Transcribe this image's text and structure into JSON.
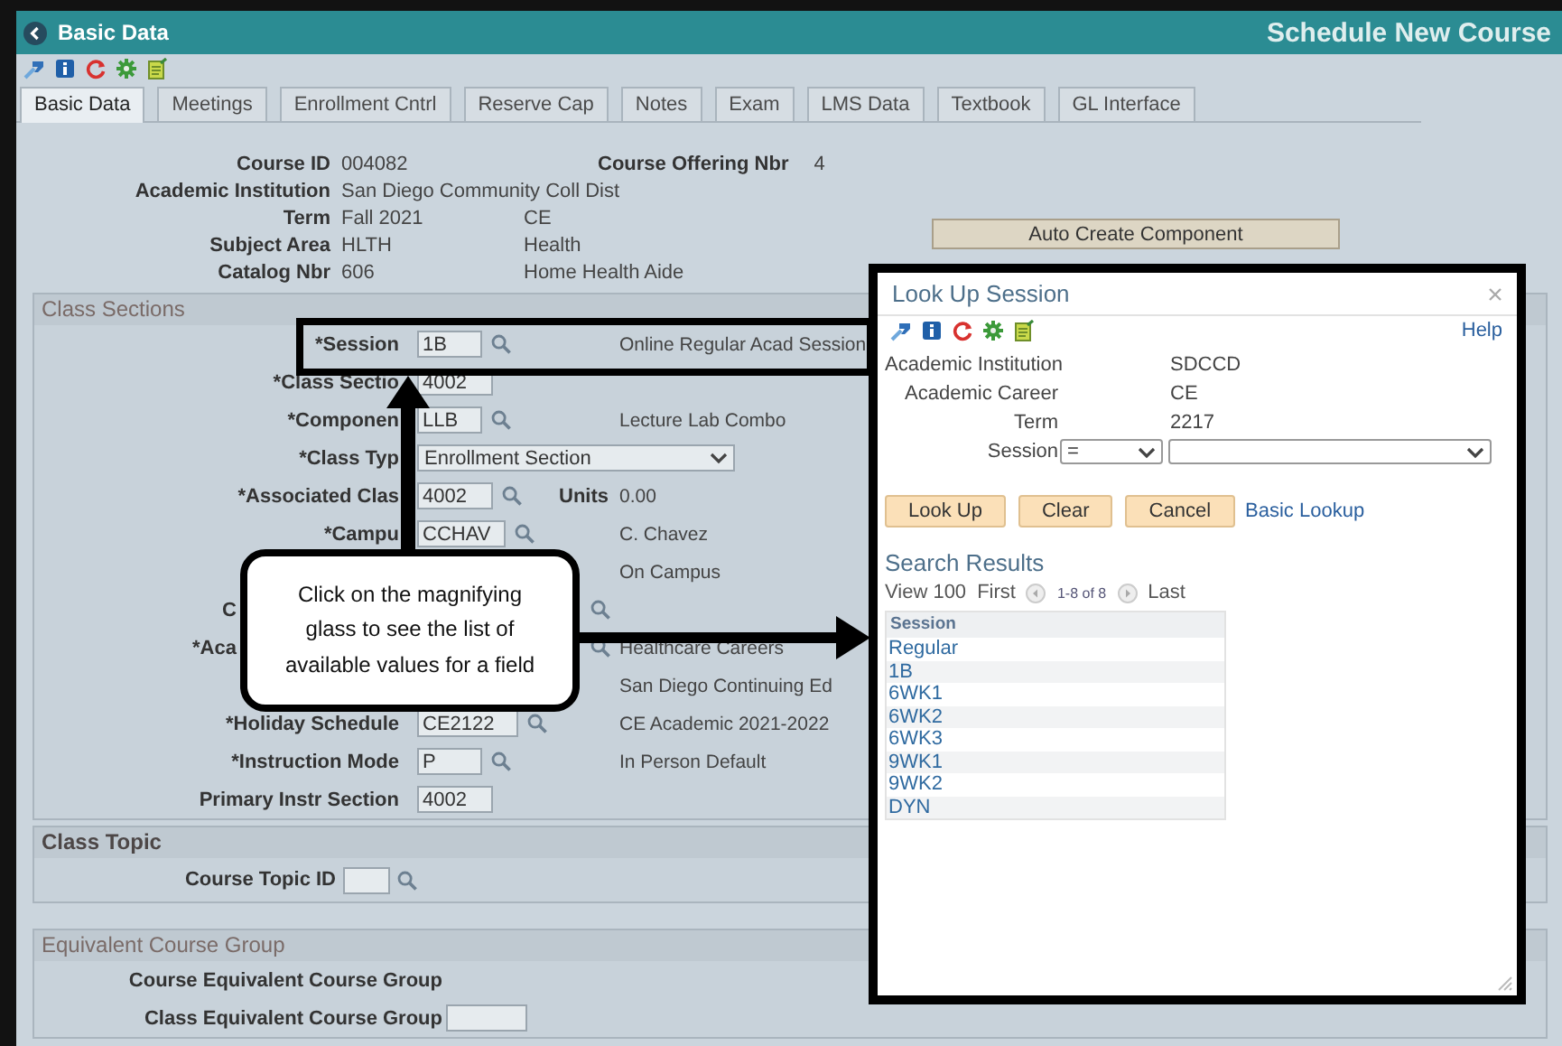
{
  "header": {
    "back_label": "Basic Data",
    "page_title": "Schedule New Course"
  },
  "tabs": [
    {
      "label": "Basic Data",
      "selected": true
    },
    {
      "label": "Meetings",
      "selected": false
    },
    {
      "label": "Enrollment Cntrl",
      "selected": false
    },
    {
      "label": "Reserve Cap",
      "selected": false
    },
    {
      "label": "Notes",
      "selected": false
    },
    {
      "label": "Exam",
      "selected": false
    },
    {
      "label": "LMS Data",
      "selected": false
    },
    {
      "label": "Textbook",
      "selected": false
    },
    {
      "label": "GL Interface",
      "selected": false
    }
  ],
  "course_info": [
    {
      "label": "Course ID",
      "value": "004082",
      "side_label": "Course Offering Nbr",
      "side_value": "4"
    },
    {
      "label": "Academic Institution",
      "value": "San Diego Community Coll Dist"
    },
    {
      "label": "Term",
      "value": "Fall 2021",
      "description": "CE"
    },
    {
      "label": "Subject Area",
      "value": "HLTH",
      "description": "Health"
    },
    {
      "label": "Catalog Nbr",
      "value": "606",
      "description": "Home Health Aide"
    }
  ],
  "auto_create_button": "Auto Create Component",
  "class_sections": {
    "title": "Class Sections",
    "rows": [
      {
        "kind": "input",
        "label": "*Session",
        "value": "1B",
        "lookup": true,
        "description": "Online Regular Acad Session"
      },
      {
        "kind": "input",
        "label": "*Class Sectio",
        "value": "4002",
        "lookup": false
      },
      {
        "kind": "input",
        "label": "*Componen",
        "value": "LLB",
        "lookup": true,
        "description": "Lecture Lab Combo"
      },
      {
        "kind": "select",
        "label": "*Class Typ",
        "value": "Enrollment Section"
      },
      {
        "kind": "input",
        "label": "*Associated Clas",
        "value": "4002",
        "lookup": true,
        "units_label": "Units",
        "units_value": "0.00"
      },
      {
        "kind": "input",
        "label": "*Campu",
        "value": "CCHAV",
        "lookup": true,
        "description": "C. Chavez"
      },
      {
        "kind": "hidden",
        "description": "On Campus"
      },
      {
        "kind": "covered",
        "label": "C",
        "lookup": true
      },
      {
        "kind": "covered",
        "label": "*Aca",
        "lookup": true,
        "description": "Healthcare Careers"
      },
      {
        "kind": "hidden",
        "description": "San Diego Continuing Ed"
      },
      {
        "kind": "input",
        "label": "*Holiday Schedule",
        "value": "CE2122",
        "lookup": true,
        "description": "CE Academic 2021-2022"
      },
      {
        "kind": "input",
        "label": "*Instruction Mode",
        "value": "P",
        "lookup": true,
        "description": "In Person Default"
      },
      {
        "kind": "input",
        "label": "Primary Instr Section",
        "value": "4002",
        "lookup": false
      }
    ]
  },
  "class_topic": {
    "title": "Class Topic",
    "label": "Course Topic ID",
    "lookup": true
  },
  "equivalent_course_group": {
    "title": "Equivalent Course Group",
    "rows": [
      {
        "kind": "text",
        "label": "Course Equivalent Course Group"
      },
      {
        "kind": "input",
        "label": "Class Equivalent Course Group"
      }
    ]
  },
  "callout": {
    "text": "Click on the magnifying glass to see the list of available values for a field"
  },
  "lookup_dialog": {
    "title": "Look Up Session",
    "help_link": "Help",
    "fields": [
      {
        "label": "Academic Institution",
        "value": "SDCCD"
      },
      {
        "label": "Academic Career",
        "value": "CE"
      },
      {
        "label": "Term",
        "value": "2217"
      }
    ],
    "search_field": {
      "label": "Session",
      "operator": "="
    },
    "buttons": [
      "Look Up",
      "Clear",
      "Cancel"
    ],
    "basic_lookup_link": "Basic Lookup",
    "results_title": "Search Results",
    "pager": {
      "view": "View 100",
      "first": "First",
      "range": "1-8 of 8",
      "last": "Last"
    },
    "column": "Session",
    "rows": [
      "Regular",
      "1B",
      "6WK1",
      "6WK2",
      "6WK3",
      "9WK1",
      "9WK2",
      "DYN"
    ]
  }
}
